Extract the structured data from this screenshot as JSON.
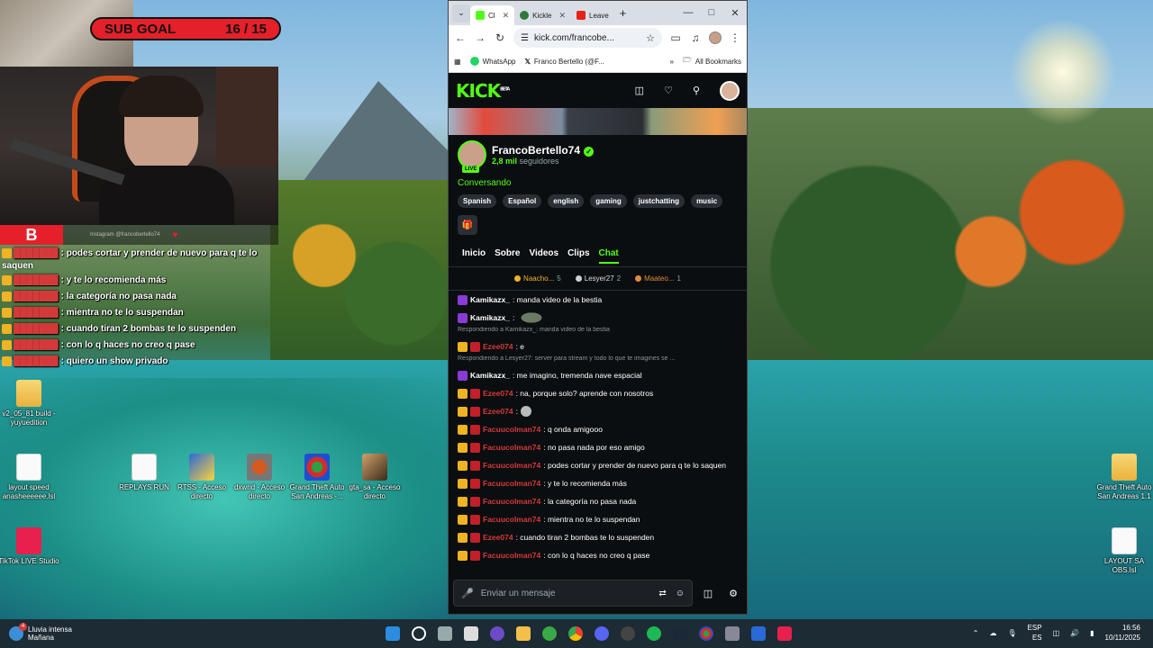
{
  "overlay": {
    "subgoal_label": "SUB GOAL",
    "subgoal_count": "16 / 15",
    "instagram": "Instagram @francobertello74",
    "chat_lines": [
      {
        "text": ": podes cortar y prender de nuevo para q te lo"
      },
      {
        "text": "saquen",
        "cont": true
      },
      {
        "text": ": y te lo recomienda más"
      },
      {
        "text": ": la categoría no pasa nada"
      },
      {
        "text": ": mientra no te lo suspendan"
      },
      {
        "text": ": cuando tiran 2 bombas te lo suspenden"
      },
      {
        "text": ": con lo q haces no creo q pase"
      },
      {
        "text": ": quiero un show privado"
      }
    ]
  },
  "desktop_icons": [
    {
      "label": "v2_05_81 build - yuyuedition",
      "kind": "folder"
    },
    {
      "label": "layout speed anasheeeeee.lsl",
      "kind": "file"
    },
    {
      "label": "REPLAYS RUN",
      "kind": "file"
    },
    {
      "label": "RTSS - Acceso directo",
      "kind": "app"
    },
    {
      "label": "dxwnd - Acceso directo",
      "kind": "dx"
    },
    {
      "label": "Grand Theft Auto San Andreas -...",
      "kind": "gta"
    },
    {
      "label": "gta_sa - Acceso directo",
      "kind": "img"
    },
    {
      "label": "TikTok LIVE Studio",
      "kind": "tiktok"
    },
    {
      "label": "Grand Theft Auto San Andreas 1.1",
      "kind": "folder"
    },
    {
      "label": "LAYOUT SA OBS.lsl",
      "kind": "file"
    }
  ],
  "browser": {
    "tabs": [
      {
        "label": "Cl",
        "active": true
      },
      {
        "label": "Kickle",
        "active": false
      },
      {
        "label": "Leave",
        "active": false
      }
    ],
    "url": "kick.com/francobe...",
    "bookmarks": [
      "WhatsApp",
      "Franco Bertello (@F...",
      "All Bookmarks"
    ]
  },
  "kick": {
    "logo": "KICK",
    "logo_sup": "BETA",
    "channel_name": "FrancoBertello74",
    "live_label": "LIVE",
    "followers_count": "2,8 mil",
    "followers_label": "seguidores",
    "category": "Conversando",
    "tags": [
      "Spanish",
      "Español",
      "english",
      "gaming",
      "justchatting",
      "music"
    ],
    "tabs": [
      "Inicio",
      "Sobre",
      "Videos",
      "Clips",
      "Chat"
    ],
    "active_tab": "Chat",
    "gifters": [
      {
        "name": "Naacho...",
        "count": "5",
        "color": "#f0b323"
      },
      {
        "name": "Lesyer27",
        "count": "2",
        "color": "#cfcfcf"
      },
      {
        "name": "Maateo...",
        "count": "1",
        "color": "#e08a3a"
      }
    ],
    "chat": [
      {
        "type": "msg",
        "badge": "purple",
        "user": "Kamikazx_",
        "ucolor": "white",
        "text": ": manda video de la bestia"
      },
      {
        "type": "msg",
        "badge": "purple",
        "user": "Kamikazx_",
        "ucolor": "white",
        "text": ":",
        "emote": true
      },
      {
        "type": "reply",
        "text": "Respondiendo a Kamikazx_: manda video de la bestia"
      },
      {
        "type": "msg",
        "badge": "gold",
        "user": "Ezee074",
        "ucolor": "red",
        "text": ": e"
      },
      {
        "type": "reply",
        "text": "Respondiendo a Lesyer27: server para stream y todo lo que te imagines se ..."
      },
      {
        "type": "msg",
        "badge": "purple",
        "user": "Kamikazx_",
        "ucolor": "white",
        "text": ": me imagino, tremenda nave espacial"
      },
      {
        "type": "msg",
        "badge": "gold",
        "user": "Ezee074",
        "ucolor": "red",
        "text": ": na, porque solo? aprende con nosotros"
      },
      {
        "type": "msg",
        "badge": "gold",
        "user": "Ezee074",
        "ucolor": "red",
        "text": ":",
        "emote_sm": true
      },
      {
        "type": "msg",
        "badge": "crown",
        "user": "Facuucolman74",
        "ucolor": "red",
        "text": ": q onda amigooo"
      },
      {
        "type": "msg",
        "badge": "crown",
        "user": "Facuucolman74",
        "ucolor": "red",
        "text": ": no pasa nada por eso amigo"
      },
      {
        "type": "msg",
        "badge": "crown",
        "user": "Facuucolman74",
        "ucolor": "red",
        "text": ": podes cortar y prender de nuevo para q te lo saquen"
      },
      {
        "type": "msg",
        "badge": "crown",
        "user": "Facuucolman74",
        "ucolor": "red",
        "text": ": y te lo recomienda más"
      },
      {
        "type": "msg",
        "badge": "crown",
        "user": "Facuucolman74",
        "ucolor": "red",
        "text": ": la categoría no pasa nada"
      },
      {
        "type": "msg",
        "badge": "crown",
        "user": "Facuucolman74",
        "ucolor": "red",
        "text": ": mientra no te lo suspendan"
      },
      {
        "type": "msg",
        "badge": "gold",
        "user": "Ezee074",
        "ucolor": "red",
        "text": ": cuando tiran 2 bombas te lo suspenden"
      },
      {
        "type": "msg",
        "badge": "crown",
        "user": "Facuucolman74",
        "ucolor": "red",
        "text": ": con lo q haces no creo q pase"
      },
      {
        "type": "msg",
        "badge": "crown",
        "user": "Facuucolman74",
        "ucolor": "red",
        "text": ": quiero un show privado"
      }
    ],
    "input_placeholder": "Enviar un mensaje"
  },
  "taskbar": {
    "weather_text": "Lluvia intensa",
    "weather_sub": "Mañana",
    "weather_badge": "4",
    "lang": "ESP",
    "lang_sub": "ES",
    "time": "16:56",
    "date": "10/11/2025"
  }
}
